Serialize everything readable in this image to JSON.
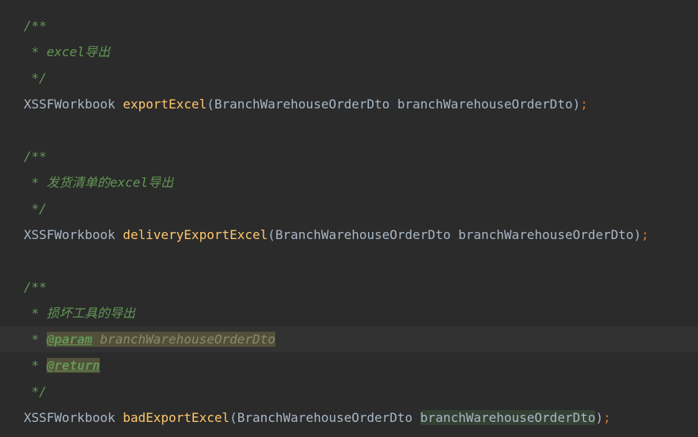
{
  "doc1": {
    "open": "/**",
    "l1": " * excel导出",
    "close": " */"
  },
  "m1": {
    "ret": "XSSFWorkbook ",
    "name": "exportExcel",
    "args": "(BranchWarehouseOrderDto branchWarehouseOrderDto)",
    "semi": ";"
  },
  "doc2": {
    "open": "/**",
    "l1": " * 发货清单的excel导出",
    "close": " */"
  },
  "m2": {
    "ret": "XSSFWorkbook ",
    "name": "deliveryExportExcel",
    "args": "(BranchWarehouseOrderDto branchWarehouseOrderDto)",
    "semi": ";"
  },
  "doc3": {
    "open": "/**",
    "l1": " * 损坏工具的导出",
    "l2pre": " * ",
    "l2tag": "@param",
    "l2sp": " ",
    "l2param": "branchWarehouseOrderDto",
    "l3pre": " * ",
    "l3tag": "@return",
    "close": " */"
  },
  "m3": {
    "ret": "XSSFWorkbook ",
    "name": "badExportExcel",
    "open": "(",
    "ptype": "BranchWarehouseOrderDto ",
    "pname": "branchWarehouseOrderDto",
    "close": ")",
    "semi": ";"
  }
}
